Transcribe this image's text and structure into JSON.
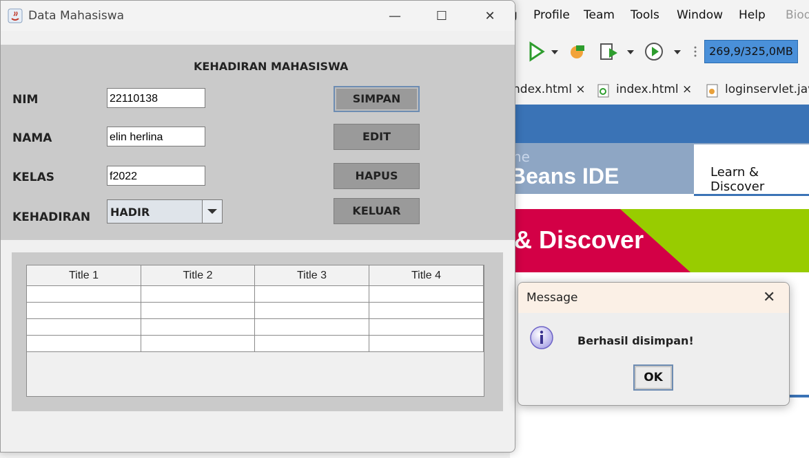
{
  "ide": {
    "menu": [
      "Profile",
      "Team",
      "Tools",
      "Window",
      "Help",
      "Biod"
    ],
    "menu_partial": "g",
    "memory_label": "269,9/325,0MB",
    "tabs": [
      "ndex.html",
      "index.html",
      "loginservlet.java"
    ],
    "tab_close": "×",
    "welcome": {
      "product_sub": "ne",
      "product_title": "Beans IDE",
      "learn_tab": "Learn & Discover",
      "banner_text": "& Discover"
    },
    "colors": {
      "nb_blue": "#3a73b6",
      "banner_red": "#e5004d",
      "banner_green": "#98cc00"
    }
  },
  "window": {
    "title": "Data Mahasiswa",
    "controls": {
      "minimize": "—",
      "maximize": "☐",
      "close": "✕"
    },
    "heading": "KEHADIRAN MAHASISWA",
    "labels": {
      "nim": "NIM",
      "nama": "NAMA",
      "kelas": "KELAS",
      "kehadiran": "KEHADIRAN"
    },
    "values": {
      "nim": "22110138",
      "nama": "elin herlina",
      "kelas": "f2022",
      "kehadiran": "HADIR"
    },
    "buttons": {
      "simpan": "SIMPAN",
      "edit": "EDIT",
      "hapus": "HAPUS",
      "keluar": "KELUAR"
    },
    "table": {
      "columns": [
        "Title 1",
        "Title 2",
        "Title 3",
        "Title 4"
      ],
      "rows": [
        [
          "",
          "",
          "",
          ""
        ],
        [
          "",
          "",
          "",
          ""
        ],
        [
          "",
          "",
          "",
          ""
        ],
        [
          "",
          "",
          "",
          ""
        ]
      ]
    }
  },
  "dialog": {
    "title": "Message",
    "close": "✕",
    "icon": "info-icon",
    "message": "Berhasil disimpan!",
    "ok": "OK"
  }
}
